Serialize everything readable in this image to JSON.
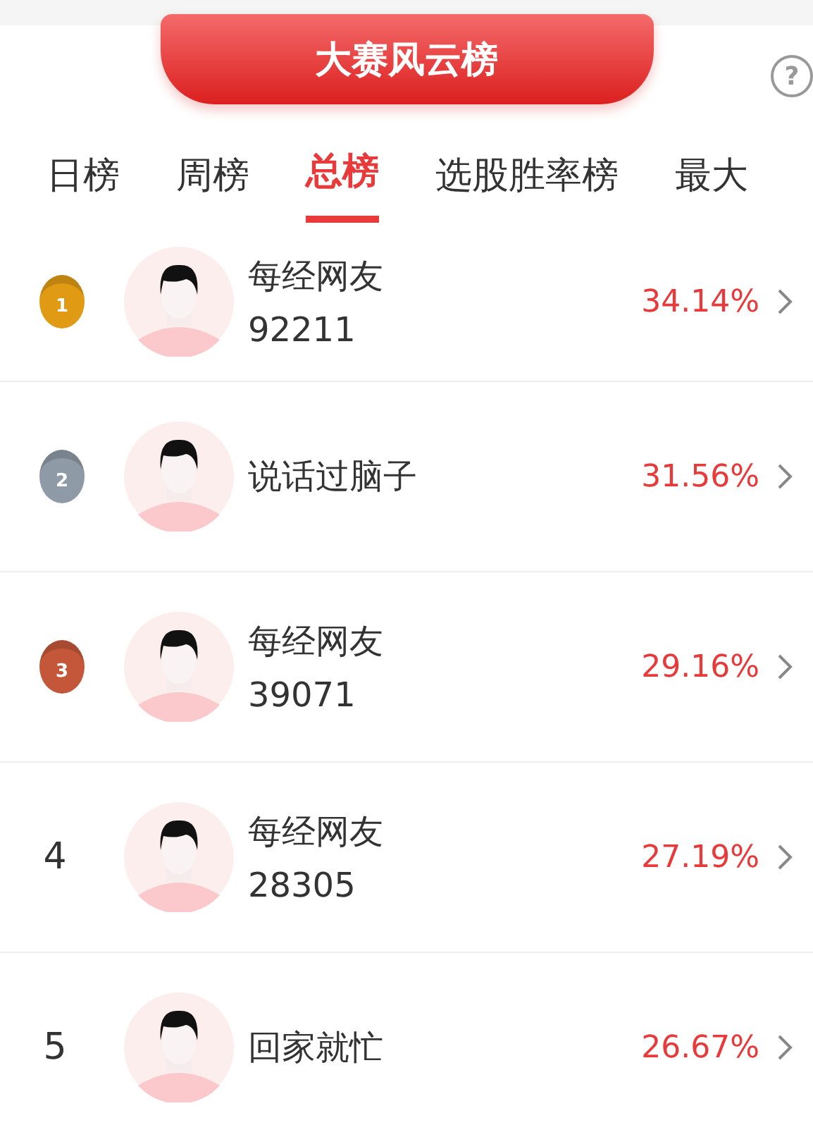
{
  "header": {
    "title": "大赛风云榜",
    "help_icon": "?"
  },
  "tabs": [
    {
      "label": "日榜",
      "selected": false
    },
    {
      "label": "周榜",
      "selected": false
    },
    {
      "label": "总榜",
      "selected": true
    },
    {
      "label": "选股胜率榜",
      "selected": false
    },
    {
      "label": "最大",
      "selected": false
    }
  ],
  "rows": [
    {
      "kind": "medal",
      "rank": "1",
      "color": "#e09a14",
      "name": "每经网友",
      "id": "92211",
      "rate": "34.14%"
    },
    {
      "kind": "medal",
      "rank": "2",
      "color": "#8e9aa6",
      "name": "说话过脑子",
      "rate": "31.56%"
    },
    {
      "kind": "medal",
      "rank": "3",
      "color": "#c4573a",
      "name": "每经网友",
      "id": "39071",
      "rate": "29.16%"
    },
    {
      "kind": "plain",
      "rank": "4",
      "name": "每经网友",
      "id": "28305",
      "rate": "27.19%"
    },
    {
      "kind": "plain",
      "rank": "5",
      "name": "回家就忙",
      "rate": "26.67%"
    }
  ]
}
